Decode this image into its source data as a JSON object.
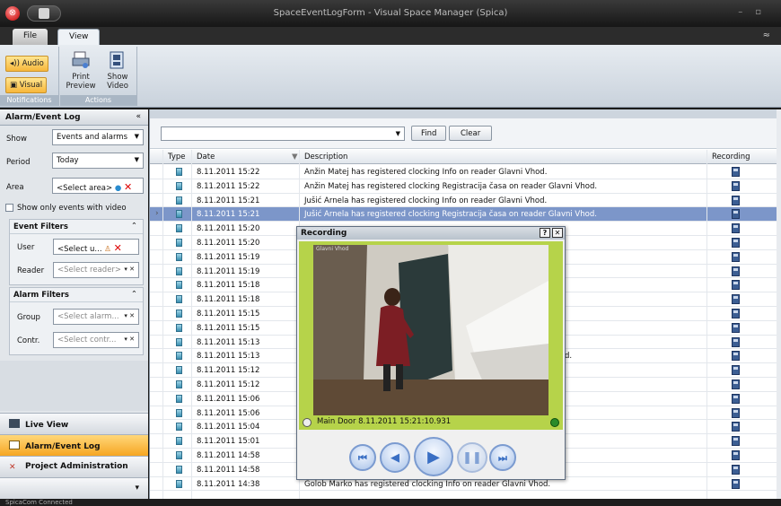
{
  "window": {
    "title": "SpaceEventLogForm - Visual Space Manager (Spica)"
  },
  "ribbon": {
    "tabs": [
      {
        "label": "File"
      },
      {
        "label": "View"
      }
    ],
    "notifications": {
      "audio_label": "Audio",
      "visual_label": "Visual",
      "group_label": "Notifications"
    },
    "actions": {
      "print_preview_label": "Print Preview",
      "show_video_label": "Show Video",
      "group_label": "Actions"
    }
  },
  "left_panel": {
    "header": "Alarm/Event Log",
    "show_label": "Show",
    "show_value": "Events and alarms",
    "period_label": "Period",
    "period_value": "Today",
    "area_label": "Area",
    "area_value": "<Select area>",
    "video_only_label": "Show only events with video",
    "event_filters": {
      "title": "Event Filters",
      "user_label": "User",
      "user_value": "<Select u...",
      "reader_label": "Reader",
      "reader_placeholder": "<Select reader>"
    },
    "alarm_filters": {
      "title": "Alarm Filters",
      "group_label": "Group",
      "group_placeholder": "<Select alarm...",
      "contr_label": "Contr.",
      "contr_placeholder": "<Select contr..."
    },
    "nav": [
      {
        "label": "Live View"
      },
      {
        "label": "Alarm/Event Log"
      },
      {
        "label": "Project Administration"
      }
    ]
  },
  "toolbar": {
    "find_label": "Find",
    "clear_label": "Clear",
    "search_value": ""
  },
  "grid": {
    "columns": {
      "type": "Type",
      "date": "Date",
      "description": "Description",
      "recording": "Recording"
    },
    "rows": [
      {
        "date": "8.11.2011 15:22",
        "description": "Anžin Matej has registered clocking Info on reader Glavni Vhod."
      },
      {
        "date": "8.11.2011 15:22",
        "description": "Anžin Matej has registered clocking Registracija časa on reader Glavni Vhod."
      },
      {
        "date": "8.11.2011 15:21",
        "description": "Jušić Arnela has registered clocking Info on reader Glavni Vhod."
      },
      {
        "date": "8.11.2011 15:21",
        "description": "Jušić Arnela has registered clocking Registracija časa on reader Glavni Vhod."
      },
      {
        "date": "8.11.2011 15:20",
        "description": ""
      },
      {
        "date": "8.11.2011 15:20",
        "description": ""
      },
      {
        "date": "8.11.2011 15:19",
        "description": ""
      },
      {
        "date": "8.11.2011 15:19",
        "description": ""
      },
      {
        "date": "8.11.2011 15:18",
        "description": ""
      },
      {
        "date": "8.11.2011 15:18",
        "description": ""
      },
      {
        "date": "8.11.2011 15:15",
        "description": ""
      },
      {
        "date": "8.11.2011 15:15",
        "description": ""
      },
      {
        "date": "8.11.2011 15:13",
        "description": ""
      },
      {
        "date": "8.11.2011 15:13",
        "description": "d."
      },
      {
        "date": "8.11.2011 15:12",
        "description": ""
      },
      {
        "date": "8.11.2011 15:12",
        "description": ""
      },
      {
        "date": "8.11.2011 15:06",
        "description": ""
      },
      {
        "date": "8.11.2011 15:06",
        "description": ""
      },
      {
        "date": "8.11.2011 15:04",
        "description": ""
      },
      {
        "date": "8.11.2011 15:01",
        "description": ""
      },
      {
        "date": "8.11.2011 14:58",
        "description": ""
      },
      {
        "date": "8.11.2011 14:58",
        "description": ""
      },
      {
        "date": "8.11.2011 14:38",
        "description": "Golob Marko has registered clocking Info on reader Glavni Vhod."
      }
    ],
    "selected_row": 3
  },
  "recording_dialog": {
    "title": "Recording",
    "help_label": "?",
    "close_label": "✕",
    "caption": "Main Door 8.11.2011 15:21:10.931",
    "camera_overlay": "Glavni Vhod"
  },
  "status_bar": {
    "text": "SpicaCom Connected"
  },
  "colors": {
    "accent": "#f6a623",
    "selection": "#7c96c9",
    "video_bar": "#b6d34a"
  }
}
